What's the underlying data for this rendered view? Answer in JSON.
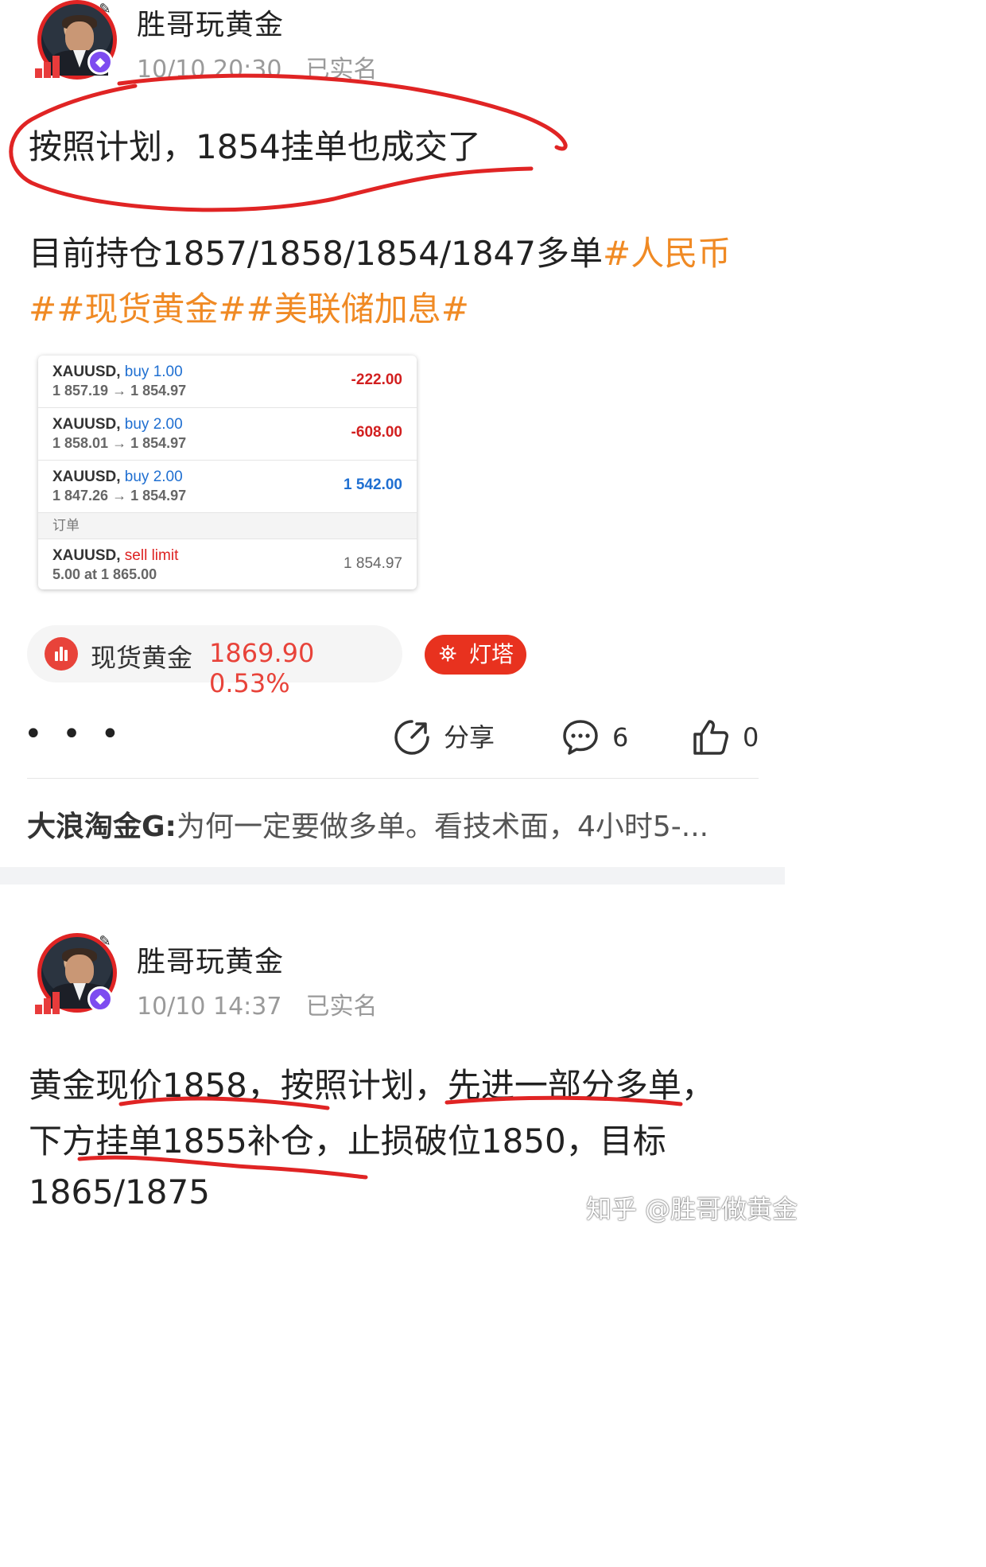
{
  "post1": {
    "username": "胜哥玩黄金",
    "time": "10/10 20:30",
    "verified": "已实名",
    "headline": "按照计划，1854挂单也成交了",
    "body_line1": "目前持仓1857/1858/1854/1847多单",
    "tag_rmb": "#人民币",
    "tag_spot": "##现货黄金##美联储加息#",
    "trades": [
      {
        "symbol": "XAUUSD,",
        "side": "buy 1.00",
        "prices": "1 857.19 → 1 854.97",
        "pnl": "-222.00"
      },
      {
        "symbol": "XAUUSD,",
        "side": "buy 2.00",
        "prices": "1 858.01 → 1 854.97",
        "pnl": "-608.00"
      },
      {
        "symbol": "XAUUSD,",
        "side": "buy 2.00",
        "prices": "1 847.26 → 1 854.97",
        "pnl": "1 542.00"
      }
    ],
    "orders_header": "订单",
    "order": {
      "symbol": "XAUUSD,",
      "side": "sell limit",
      "detail": "5.00 at 1 865.00",
      "price": "1 854.97"
    },
    "quote": {
      "name": "现货黄金",
      "value": "1869.90 0.53%"
    },
    "lighthouse": "灯塔",
    "more": "• • •",
    "share": "分享",
    "comments": "6",
    "likes": "0",
    "comment_user": "大浪淘金G:",
    "comment_text": "为何一定要做多单。看技术面，4小时5-..."
  },
  "post2": {
    "username": "胜哥玩黄金",
    "time": "10/10 14:37",
    "verified": "已实名",
    "line1": "黄金现价1858，按照计划，先进一部分多单，",
    "line2": "下方挂单1855补仓，止损破位1850，目标",
    "line3": "1865/1875"
  },
  "watermark": "知乎 @胜哥做黄金",
  "colors": {
    "accent": "#f08a24",
    "red": "#e8433a",
    "blue": "#1f6fd1",
    "annotation": "#e02424"
  }
}
